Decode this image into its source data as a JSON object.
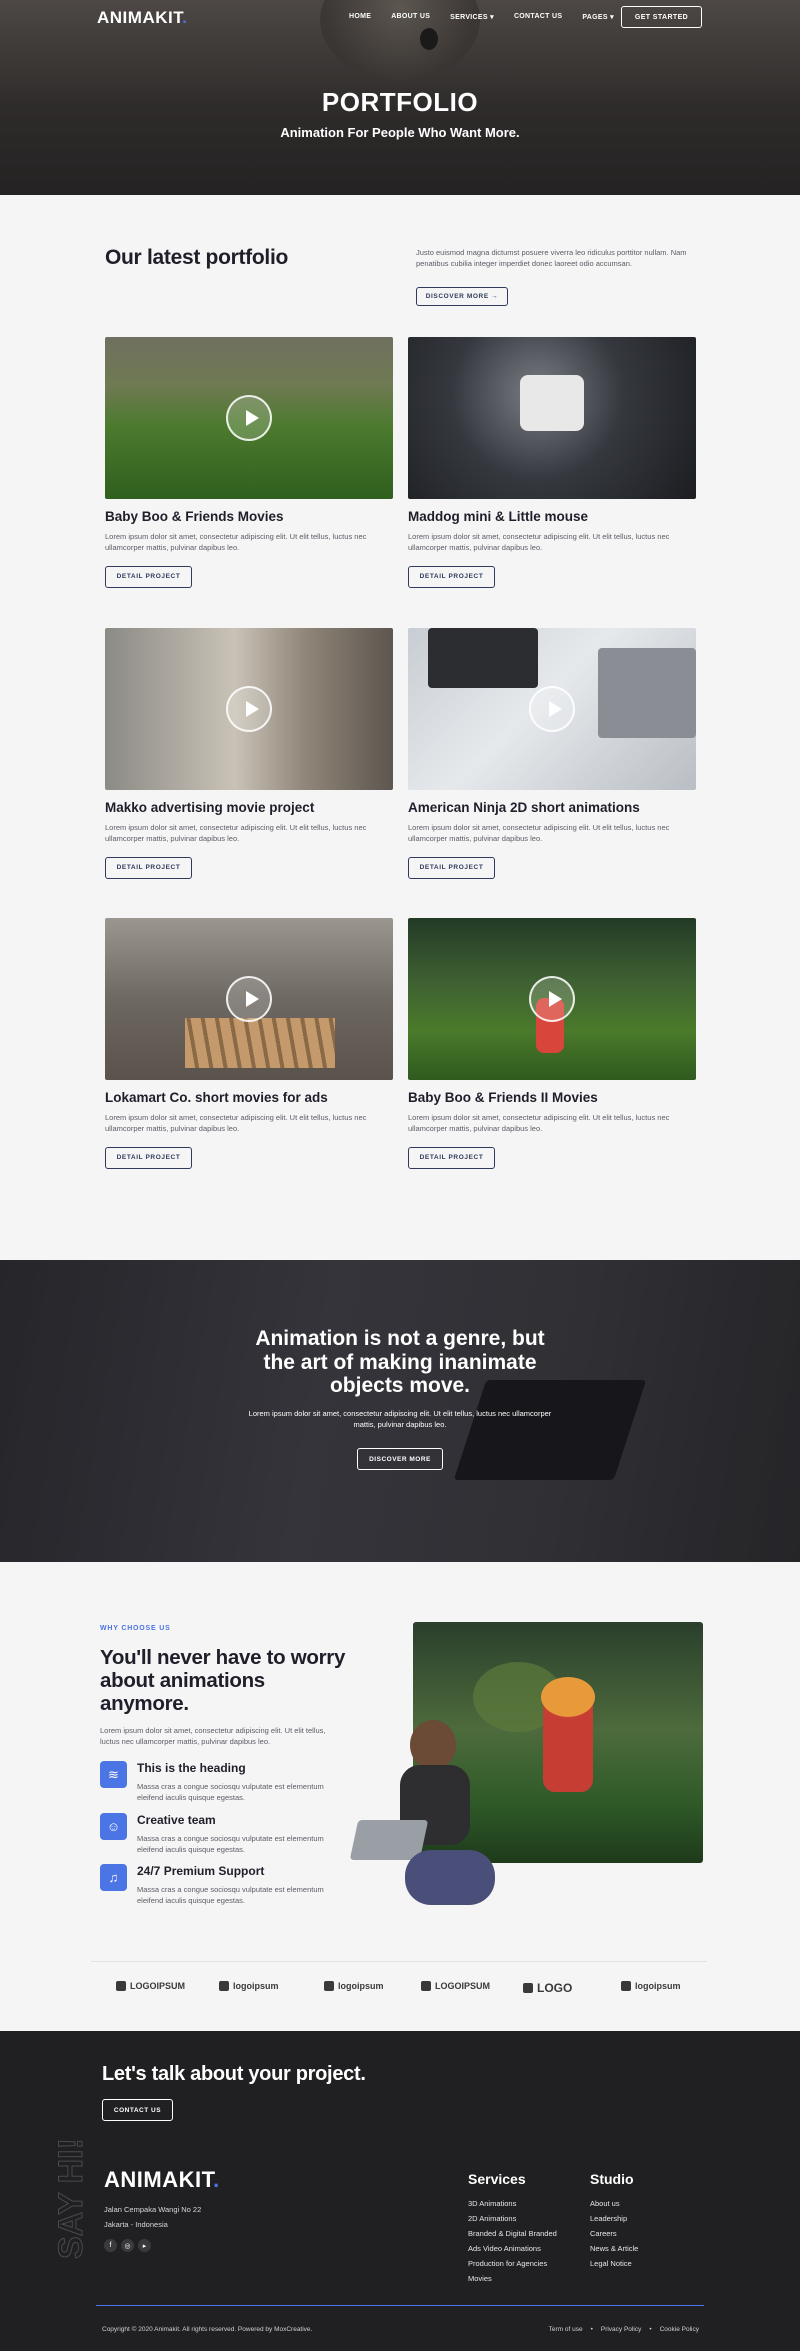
{
  "brand": {
    "name": "ANIMAKIT",
    "dot": ".",
    "accent": "#4b74e4"
  },
  "nav": {
    "items": [
      "HOME",
      "ABOUT US",
      "SERVICES",
      "CONTACT US",
      "PAGES"
    ],
    "cta": "GET STARTED"
  },
  "hero": {
    "title": "PORTFOLIO",
    "subtitle": "Animation For People Who Want More."
  },
  "portfolio": {
    "heading": "Our latest portfolio",
    "intro": "Justo euismod magna dictumst posuere viverra leo ridiculus porttitor nullam. Nam penatibus cubilia integer imperdiet donec laoreet odio accumsan.",
    "discover": "DISCOVER MORE",
    "arrow": "→",
    "items": [
      {
        "title": "Baby Boo & Friends Movies",
        "desc": "Lorem ipsum dolor sit amet, consectetur adipiscing elit. Ut elit tellus, luctus nec ullamcorper mattis, pulvinar dapibus leo.",
        "button": "DETAIL PROJECT"
      },
      {
        "title": "Maddog mini & Little mouse",
        "desc": "Lorem ipsum dolor sit amet, consectetur adipiscing elit. Ut elit tellus, luctus nec ullamcorper mattis, pulvinar dapibus leo.",
        "button": "DETAIL PROJECT"
      },
      {
        "title": "Makko advertising movie project",
        "desc": "Lorem ipsum dolor sit amet, consectetur adipiscing elit. Ut elit tellus, luctus nec ullamcorper mattis, pulvinar dapibus leo.",
        "button": "DETAIL PROJECT"
      },
      {
        "title": "American Ninja 2D short animations",
        "desc": "Lorem ipsum dolor sit amet, consectetur adipiscing elit. Ut elit tellus, luctus nec ullamcorper mattis, pulvinar dapibus leo.",
        "button": "DETAIL PROJECT"
      },
      {
        "title": "Lokamart Co. short movies for ads",
        "desc": "Lorem ipsum dolor sit amet, consectetur adipiscing elit. Ut elit tellus, luctus nec ullamcorper mattis, pulvinar dapibus leo.",
        "button": "DETAIL PROJECT"
      },
      {
        "title": "Baby Boo & Friends II Movies",
        "desc": "Lorem ipsum dolor sit amet, consectetur adipiscing elit. Ut elit tellus, luctus nec ullamcorper mattis, pulvinar dapibus leo.",
        "button": "DETAIL PROJECT"
      }
    ]
  },
  "banner": {
    "title": "Animation is not a genre, but the art of making inanimate objects move.",
    "desc": "Lorem ipsum dolor sit amet, consectetur adipiscing elit. Ut elit tellus, luctus nec ullamcorper mattis, pulvinar dapibus leo.",
    "button": "DISCOVER MORE"
  },
  "why": {
    "tag": "WHY CHOOSE US",
    "title": "You'll never have to worry about animations anymore.",
    "desc": "Lorem ipsum dolor sit amet, consectetur adipiscing elit. Ut elit tellus, luctus nec ullamcorper mattis, pulvinar dapibus leo.",
    "features": [
      {
        "title": "This is the heading",
        "desc": "Massa cras a congue sociosqu vulputate est elementum eleifend iaculis quisque egestas.",
        "icon": "layers-icon"
      },
      {
        "title": "Creative team",
        "desc": "Massa cras a congue sociosqu vulputate est elementum eleifend iaculis quisque egestas.",
        "icon": "team-icon"
      },
      {
        "title": "24/7 Premium Support",
        "desc": "Massa cras a congue sociosqu vulputate est elementum eleifend iaculis quisque egestas.",
        "icon": "headphones-icon"
      }
    ]
  },
  "logos": [
    "LOGOIPSUM",
    "logoipsum",
    "logoipsum",
    "LOGOIPSUM",
    "LOGO",
    "logoipsum"
  ],
  "footer": {
    "sayhi": "SAY HI!",
    "talk": "Let's talk about your project.",
    "contact": "CONTACT US",
    "address1": "Jalan Cempaka Wangi No 22",
    "address2": "Jakarta - Indonesia",
    "services_title": "Services",
    "services": [
      "3D Animations",
      "2D Animations",
      "Branded & Digital Branded",
      "Ads Video Animations",
      "Production for Agencies",
      "Movies"
    ],
    "studio_title": "Studio",
    "studio": [
      "About us",
      "Leadership",
      "Careers",
      "News & Article",
      "Legal Notice"
    ],
    "copyright": "Copyright © 2020 Animakit. All rights reserved. Powered by MoxCreative.",
    "legal": [
      "Term of use",
      "Privacy Policy",
      "Cookie Policy"
    ]
  }
}
